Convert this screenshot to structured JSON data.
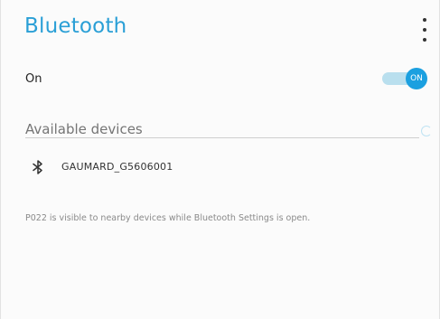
{
  "header": {
    "title": "Bluetooth",
    "menu_icon": "more-vert-icon"
  },
  "bluetooth_toggle": {
    "label": "On",
    "switch_text": "ON",
    "state": true,
    "accent_color": "#1ba0e0"
  },
  "available_devices": {
    "header": "Available devices",
    "scanning_icon": "progress-spinner-icon",
    "devices": [
      {
        "icon": "bluetooth-icon",
        "name": "GAUMARD_G5606001"
      }
    ]
  },
  "footer": {
    "visibility_note": "P022 is visible to nearby devices while Bluetooth Settings is open."
  }
}
